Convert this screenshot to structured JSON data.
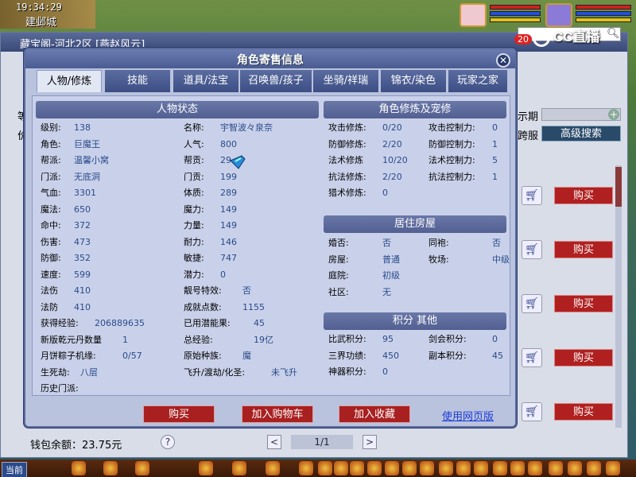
{
  "hud": {
    "clock": "19:34:29",
    "city": "建邺城",
    "stream_brand": "CC直播",
    "message_count": "20",
    "channel": "当前"
  },
  "shop": {
    "title": "藏宝阁-河北2区 [燕赵风云]",
    "label_left_1": "等",
    "label_left_2": "价",
    "label_right_1": "示期",
    "label_right_2": "跨服",
    "advanced_search": "高级搜索",
    "row_buy_label": "购买",
    "wallet_label": "钱包余额：23.75元",
    "help": "?",
    "page": "1/1",
    "prev": "<",
    "next": ">"
  },
  "dialog": {
    "title": "角色寄售信息",
    "close": "✕",
    "tabs": [
      "人物/修炼",
      "技能",
      "道具/法宝",
      "召唤兽/孩子",
      "坐骑/祥瑞",
      "锦衣/染色",
      "玩家之家"
    ],
    "active_tab": 0,
    "sections": {
      "status": "人物状态",
      "cultivation": "角色修炼及宠修",
      "housing": "居住房屋",
      "points": "积分 其他"
    },
    "status_left": [
      {
        "label": "级别:",
        "value": "138"
      },
      {
        "label": "角色:",
        "value": "巨魔王"
      },
      {
        "label": "帮派:",
        "value": "温馨小窝"
      },
      {
        "label": "门派:",
        "value": "无底洞"
      },
      {
        "label": "气血:",
        "value": "3301"
      },
      {
        "label": "魔法:",
        "value": "650"
      },
      {
        "label": "命中:",
        "value": "372"
      },
      {
        "label": "伤害:",
        "value": "473"
      },
      {
        "label": "防御:",
        "value": "352"
      },
      {
        "label": "速度:",
        "value": "599"
      },
      {
        "label": "法伤",
        "value": "410"
      },
      {
        "label": "法防",
        "value": "410"
      },
      {
        "label": "获得经验:",
        "value": "206889635"
      },
      {
        "label": "新版乾元丹数量",
        "value": "1"
      },
      {
        "label": "月饼粽子机缘:",
        "value": "0/57"
      },
      {
        "label": "生死劫:",
        "value": "八层"
      },
      {
        "label": "历史门派:",
        "value": ""
      }
    ],
    "status_right": [
      {
        "label": "名称:",
        "value": "宇智波々泉奈"
      },
      {
        "label": "人气:",
        "value": "800"
      },
      {
        "label": "帮贡:",
        "value": "29"
      },
      {
        "label": "门贡:",
        "value": "199"
      },
      {
        "label": "体质:",
        "value": "289"
      },
      {
        "label": "魔力:",
        "value": "149"
      },
      {
        "label": "力量:",
        "value": "149"
      },
      {
        "label": "耐力:",
        "value": "146"
      },
      {
        "label": "敏捷:",
        "value": "747"
      },
      {
        "label": "潜力:",
        "value": "0"
      },
      {
        "label": "靓号特效:",
        "value": "否"
      },
      {
        "label": "成就点数:",
        "value": "1155"
      },
      {
        "label": "已用潜能果:",
        "value": "45"
      },
      {
        "label": "总经验:",
        "value": "19亿"
      },
      {
        "label": "原始种族:",
        "value": "魔"
      },
      {
        "label": "飞升/渡劫/化圣:",
        "value": "未飞升"
      }
    ],
    "cultivation": [
      {
        "label": "攻击修炼:",
        "value": "0/20",
        "label2": "攻击控制力:",
        "value2": "0"
      },
      {
        "label": "防御修炼:",
        "value": "2/20",
        "label2": "防御控制力:",
        "value2": "1"
      },
      {
        "label": "法术修炼",
        "value": "10/20",
        "label2": "法术控制力:",
        "value2": "5"
      },
      {
        "label": "抗法修炼:",
        "value": "2/20",
        "label2": "抗法控制力:",
        "value2": "1"
      },
      {
        "label": "猎术修炼:",
        "value": "0",
        "label2": "",
        "value2": ""
      }
    ],
    "housing": [
      {
        "label": "婚否:",
        "value": "否",
        "label2": "同袍:",
        "value2": "否"
      },
      {
        "label": "房屋:",
        "value": "普通",
        "label2": "牧场:",
        "value2": "中级"
      },
      {
        "label": "庭院:",
        "value": "初级",
        "label2": "",
        "value2": ""
      },
      {
        "label": "社区:",
        "value": "无",
        "label2": "",
        "value2": ""
      }
    ],
    "points": [
      {
        "label": "比武积分:",
        "value": "95",
        "label2": "剑会积分:",
        "value2": "0"
      },
      {
        "label": "三界功绩:",
        "value": "450",
        "label2": "副本积分:",
        "value2": "45"
      },
      {
        "label": "神器积分:",
        "value": "0",
        "label2": "",
        "value2": ""
      }
    ],
    "buttons": {
      "buy": "购买",
      "add_cart": "加入购物车",
      "add_fav": "加入收藏",
      "web_link": "使用网页版"
    }
  }
}
